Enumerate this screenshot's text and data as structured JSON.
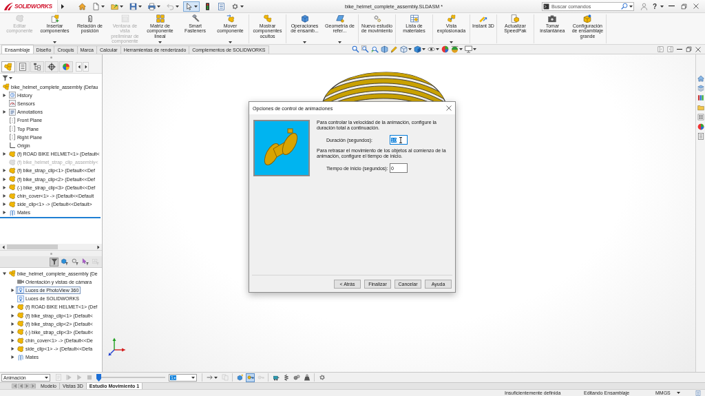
{
  "title_bar": {
    "logo": "SOLIDWORKS",
    "quick_access": [
      {
        "kind": "home",
        "dropdown": false,
        "disabled": false,
        "pressed": false
      },
      {
        "kind": "new",
        "dropdown": true,
        "disabled": false,
        "pressed": false
      },
      {
        "kind": "open",
        "dropdown": true,
        "disabled": false,
        "pressed": false
      },
      {
        "kind": "save",
        "dropdown": true,
        "disabled": false,
        "pressed": false
      },
      {
        "kind": "print",
        "dropdown": true,
        "disabled": false,
        "pressed": false
      },
      {
        "kind": "undo",
        "dropdown": true,
        "disabled": true,
        "pressed": false
      },
      {
        "kind": "select",
        "dropdown": true,
        "disabled": false,
        "pressed": true
      },
      {
        "kind": "rebuild",
        "dropdown": false,
        "disabled": false,
        "pressed": false
      },
      {
        "kind": "properties",
        "dropdown": false,
        "disabled": false,
        "pressed": false
      },
      {
        "kind": "options",
        "dropdown": true,
        "disabled": false,
        "pressed": false
      }
    ],
    "title": "bike_helmet_complete_assembly.SLDASM *",
    "search": {
      "placeholder": "Buscar comandos"
    },
    "help": "?"
  },
  "ribbon": {
    "groups": [
      [
        {
          "kind": "edit",
          "label": "Editar componente",
          "dropdown": false,
          "disabled": true
        },
        {
          "kind": "insert",
          "label": "Insertar componentes",
          "dropdown": true,
          "disabled": false
        },
        {
          "kind": "mate",
          "label": "Relación de posición",
          "dropdown": false,
          "disabled": false
        },
        {
          "kind": "preview",
          "label": "Ventana de vista preliminar de componente",
          "dropdown": false,
          "disabled": true
        },
        {
          "kind": "pattern",
          "label": "Matriz de componente lineal",
          "dropdown": true,
          "disabled": false
        },
        {
          "kind": "fasteners",
          "label": "Smart Fasteners",
          "dropdown": false,
          "disabled": false
        },
        {
          "kind": "move",
          "label": "Mover componente",
          "dropdown": true,
          "disabled": false
        }
      ],
      [
        {
          "kind": "show",
          "label": "Mostrar componentes ocultos",
          "dropdown": false,
          "disabled": false
        }
      ],
      [
        {
          "kind": "features",
          "label": "Operaciones de ensamb...",
          "dropdown": true,
          "disabled": false
        },
        {
          "kind": "geometry",
          "label": "Geometría de refer...",
          "dropdown": true,
          "disabled": false
        }
      ],
      [
        {
          "kind": "motion",
          "label": "Nuevo estudio de movimiento",
          "dropdown": false,
          "disabled": false
        }
      ],
      [
        {
          "kind": "bom",
          "label": "Lista de materiales",
          "dropdown": false,
          "disabled": false
        }
      ],
      [
        {
          "kind": "explode",
          "label": "Vista explosionada",
          "dropdown": true,
          "disabled": false
        }
      ],
      [
        {
          "kind": "instant3d",
          "label": "Instant 3D",
          "dropdown": false,
          "disabled": false
        }
      ],
      [
        {
          "kind": "speedpak",
          "label": "Actualizar SpeedPak",
          "dropdown": false,
          "disabled": false
        }
      ],
      [
        {
          "kind": "snapshot",
          "label": "Tomar instantánea",
          "dropdown": false,
          "disabled": false
        },
        {
          "kind": "largeassembly",
          "label": "Configuración de ensamblaje grande",
          "dropdown": false,
          "disabled": false
        }
      ]
    ]
  },
  "command_tabs": [
    {
      "label": "Ensamblaje",
      "selected": true
    },
    {
      "label": "Diseño",
      "selected": false
    },
    {
      "label": "Croquis",
      "selected": false
    },
    {
      "label": "Marca",
      "selected": false
    },
    {
      "label": "Calcular",
      "selected": false
    },
    {
      "label": "Herramientas de renderizado",
      "selected": false
    },
    {
      "label": "Complementos de SOLIDWORKS",
      "selected": false
    }
  ],
  "feature_manager": {
    "tabs": [
      {
        "kind": "feature",
        "selected": true
      },
      {
        "kind": "property",
        "selected": false
      },
      {
        "kind": "configuration",
        "selected": false
      },
      {
        "kind": "dimxpert",
        "selected": false
      },
      {
        "kind": "display",
        "selected": false
      }
    ],
    "tree": [
      {
        "label": "bike_helmet_complete_assembly (Defau",
        "kind": "assembly",
        "children": [
          {
            "label": "History",
            "kind": "history",
            "expanded": false,
            "suppressed": false
          },
          {
            "label": "Sensors",
            "kind": "sensors",
            "suppressed": false
          },
          {
            "label": "Annotations",
            "kind": "annotations",
            "expanded": false,
            "suppressed": false
          },
          {
            "label": "Front Plane",
            "kind": "plane",
            "suppressed": false
          },
          {
            "label": "Top Plane",
            "kind": "plane",
            "suppressed": false
          },
          {
            "label": "Right Plane",
            "kind": "plane",
            "suppressed": false
          },
          {
            "label": "Origin",
            "kind": "origin",
            "suppressed": false
          },
          {
            "label": "(f) ROAD BIKE HELMET<1> (Default<",
            "kind": "part",
            "expanded": false,
            "suppressed": false
          },
          {
            "label": "(f) bike_helmet_strap_clip_assembly<",
            "kind": "part",
            "suppressed": true
          },
          {
            "label": "(f) bike_strap_clip<1> (Default<<Def",
            "kind": "part",
            "expanded": false,
            "suppressed": false
          },
          {
            "label": "(f) bike_strap_clip<2> (Default<<Def",
            "kind": "part",
            "expanded": false,
            "suppressed": false
          },
          {
            "label": "(-) bike_strap_clip<3> (Default<<Def",
            "kind": "part",
            "expanded": false,
            "suppressed": false
          },
          {
            "label": "chin_cover<1> -> (Default<<Default",
            "kind": "part",
            "expanded": false,
            "suppressed": false
          },
          {
            "label": "side_clip<1> -> (Default<<Default>",
            "kind": "part",
            "expanded": false,
            "suppressed": false
          },
          {
            "label": "Mates",
            "kind": "mates",
            "expanded": false,
            "suppressed": false
          }
        ]
      }
    ]
  },
  "motion_manager": {
    "filters": [
      {
        "kind": "filter",
        "pressed": true,
        "disabled": false
      },
      {
        "kind": "animated",
        "pressed": false,
        "disabled": false
      },
      {
        "kind": "driving",
        "pressed": false,
        "disabled": false
      },
      {
        "kind": "selected",
        "pressed": false,
        "disabled": false
      },
      {
        "kind": "results",
        "pressed": false,
        "disabled": true
      }
    ],
    "tree": [
      {
        "label": "bike_helmet_complete_assembly (De",
        "kind": "assembly",
        "expanded": true,
        "selected": false,
        "children": [
          {
            "label": "Orientación y vistas de cámara",
            "kind": "camera",
            "selected": false
          },
          {
            "label": "Luces de PhotoView 360",
            "kind": "lights",
            "expanded": false,
            "selected": true
          },
          {
            "label": "Luces de SOLIDWORKS",
            "kind": "lights",
            "selected": false
          },
          {
            "label": "(f) ROAD BIKE HELMET<1> (Def",
            "kind": "part",
            "expanded": false,
            "selected": false
          },
          {
            "label": "(f) bike_strap_clip<1> (Default<",
            "kind": "part",
            "expanded": false,
            "selected": false
          },
          {
            "label": "(f) bike_strap_clip<2> (Default<",
            "kind": "part",
            "expanded": false,
            "selected": false
          },
          {
            "label": "(-) bike_strap_clip<3> (Default<",
            "kind": "part",
            "expanded": false,
            "selected": false
          },
          {
            "label": "chin_cover<1> -> (Default<<De",
            "kind": "part",
            "expanded": false,
            "selected": false
          },
          {
            "label": "side_clip<1> -> (Default<<Defa",
            "kind": "part",
            "expanded": false,
            "selected": false
          },
          {
            "label": "Mates",
            "kind": "mates",
            "expanded": false,
            "selected": false
          }
        ]
      }
    ],
    "study_type": "Animación",
    "playback": [
      {
        "kind": "calculate",
        "disabled": true
      },
      {
        "kind": "start",
        "disabled": true
      },
      {
        "kind": "play",
        "disabled": true
      },
      {
        "kind": "stop",
        "disabled": true
      }
    ],
    "timeline": {
      "level": 0
    },
    "speed": {
      "value": "1x",
      "highlighted": true
    },
    "tools": [
      [
        {
          "kind": "forward",
          "dropdown": true,
          "pressed": false,
          "disabled": false
        },
        {
          "kind": "copy",
          "dropdown": false,
          "pressed": false,
          "disabled": true
        }
      ],
      [
        {
          "kind": "wizard",
          "dropdown": false,
          "pressed": false,
          "disabled": false
        },
        {
          "kind": "autokey",
          "dropdown": false,
          "pressed": true,
          "disabled": false
        },
        {
          "kind": "addkey",
          "dropdown": false,
          "pressed": false,
          "disabled": true
        }
      ],
      [
        {
          "kind": "motor",
          "dropdown": false,
          "pressed": false,
          "disabled": false
        },
        {
          "kind": "spring",
          "dropdown": false,
          "pressed": false,
          "disabled": false
        },
        {
          "kind": "contact",
          "dropdown": false,
          "pressed": false,
          "disabled": false
        },
        {
          "kind": "gravity",
          "dropdown": false,
          "pressed": false,
          "disabled": false
        }
      ],
      [
        {
          "kind": "settings",
          "dropdown": false,
          "pressed": false,
          "disabled": false
        }
      ]
    ],
    "study_tabs": [
      {
        "label": "Modelo",
        "selected": false
      },
      {
        "label": "Vistas 3D",
        "selected": false
      },
      {
        "label": "Estudio Movimiento 1",
        "selected": true
      }
    ]
  },
  "dialog": {
    "title": "Opciones de control de animaciones",
    "sections": [
      {
        "text": "Para controlar la velocidad de la animación, configure la duración total a continuación.",
        "field": {
          "label": "Duración (segundos):",
          "value": "10",
          "focused": true
        }
      },
      {
        "text": "Para retrasar el movimiento de los objetos al comienzo de la animación, configure el tiempo de inicio.",
        "field": {
          "label": "Tiempo de inicio (segundos):",
          "value": "0",
          "focused": false
        }
      }
    ],
    "buttons": [
      "< Atrás",
      "Finalizar",
      "Cancelar",
      "Ayuda"
    ]
  },
  "status_bar": {
    "items": [
      "Insuficientemente definida",
      "Editando Ensamblaje",
      "MMGS"
    ]
  }
}
